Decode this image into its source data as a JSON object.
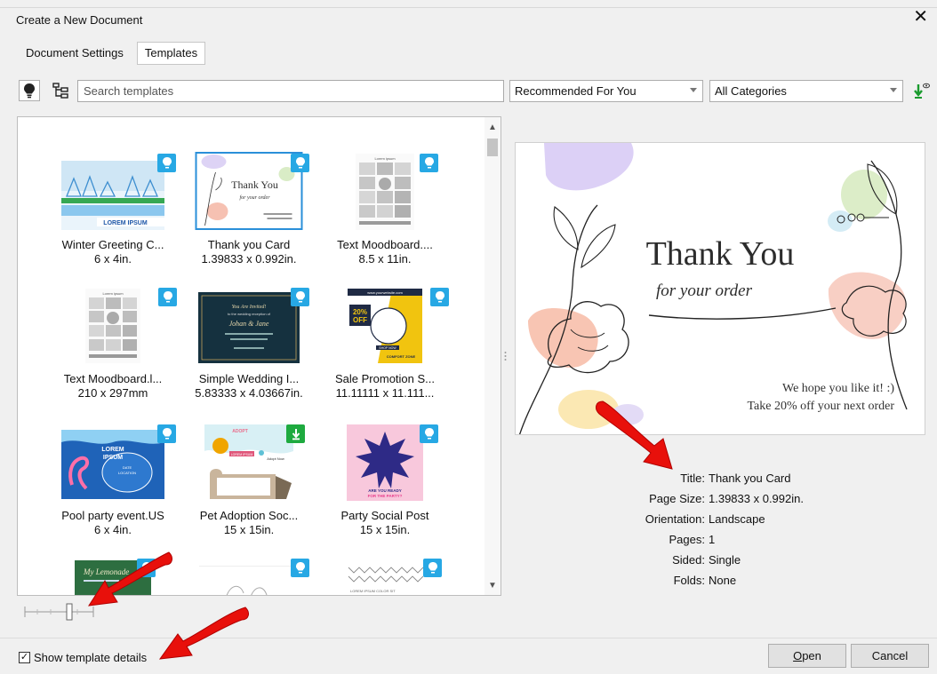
{
  "window": {
    "title": "Create a New Document",
    "close_glyph": "✕"
  },
  "tabs": [
    {
      "label": "Document Settings",
      "active": false
    },
    {
      "label": "Templates",
      "active": true
    }
  ],
  "toolbar": {
    "lightbulb_icon": "lightbulb-icon",
    "hierarchy_icon": "hierarchy-icon",
    "search_placeholder": "Search templates",
    "recommend_select": "Recommended For You",
    "category_select": "All Categories",
    "download_icon": "download-icon"
  },
  "templates": [
    {
      "name": "Winter Greeting C...",
      "size": "6 x 4in.",
      "badge": "blue",
      "selected": false
    },
    {
      "name": "Thank you Card",
      "size": "1.39833 x 0.992in.",
      "badge": "blue",
      "selected": true
    },
    {
      "name": "Text Moodboard....",
      "size": "8.5 x 11in.",
      "badge": "blue",
      "selected": false
    },
    {
      "name": "Text Moodboard.l...",
      "size": "210 x 297mm",
      "badge": "blue",
      "selected": false
    },
    {
      "name": "Simple Wedding I...",
      "size": "5.83333 x 4.03667in.",
      "badge": "blue",
      "selected": false
    },
    {
      "name": "Sale Promotion S...",
      "size": "11.11111 x 11.111...",
      "badge": "blue",
      "selected": false
    },
    {
      "name": "Pool party event.US",
      "size": "6 x 4in.",
      "badge": "blue",
      "selected": false
    },
    {
      "name": "Pet Adoption Soc...",
      "size": "15 x 15in.",
      "badge": "green",
      "selected": false
    },
    {
      "name": "Party Social Post",
      "size": "15 x 15in.",
      "badge": "blue",
      "selected": false
    }
  ],
  "thumb_text": {
    "winter": "LOREM IPSUM",
    "thanks_title": "Thank You",
    "thanks_sub": "for your order",
    "moodboard": "Lorem ipsum",
    "wedding_1": "You Are Invited!",
    "wedding_2": "to the wedding reception of",
    "wedding_names": "Johan & Jane",
    "sale_top": "www.yourwebsite.com",
    "sale_pct": "20%",
    "sale_off": "OFF",
    "sale_btn": "SHOP NOW",
    "sale_brand": "COMFORT ZONE",
    "pool_1": "LOREM",
    "pool_2": "IPSUM",
    "pool_3": "DATE",
    "pool_4": "LOCATION",
    "pet_1": "ADOPT",
    "pet_2": "LOREM IPSUM",
    "pet_3": "Adopt Now",
    "party_1": "ARE YOU READY",
    "party_2": "FOR THE PARTY?",
    "partial_1": "My Lemonade",
    "partial_3": "LOREM IPSUM COLOR SIT"
  },
  "preview": {
    "title": "Thank You",
    "subtitle": "for your order",
    "line1": "We hope you like it! :)",
    "line2": "Take 20% off your next order"
  },
  "details": [
    {
      "label": "Title:",
      "value": "Thank you Card"
    },
    {
      "label": "Page Size:",
      "value": "1.39833 x 0.992in."
    },
    {
      "label": "Orientation:",
      "value": "Landscape"
    },
    {
      "label": "Pages:",
      "value": "1"
    },
    {
      "label": "Sided:",
      "value": "Single"
    },
    {
      "label": "Folds:",
      "value": "None"
    }
  ],
  "footer": {
    "show_details_label": "Show template details",
    "show_details_checked": true,
    "check_glyph": "✓",
    "open_label_mnemonic": "O",
    "open_label_rest": "pen",
    "cancel_label": "Cancel"
  },
  "colors": {
    "badge_blue": "#27a8e4",
    "badge_green": "#1eaa3f",
    "selection": "#2a8fd9",
    "annotation_arrow": "#e8100b"
  }
}
